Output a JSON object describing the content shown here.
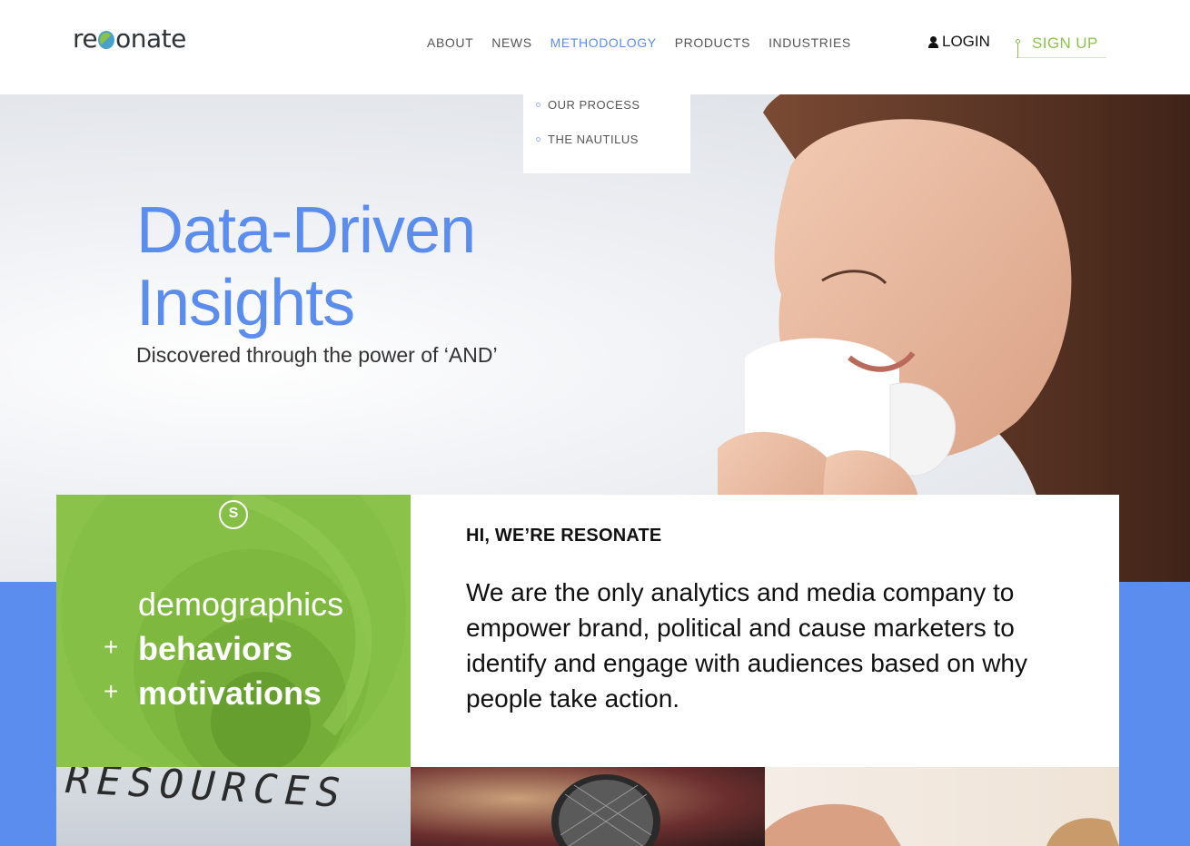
{
  "brand": {
    "logo_left": "re",
    "logo_right": "onate"
  },
  "nav": {
    "items": [
      {
        "label": "ABOUT"
      },
      {
        "label": "NEWS"
      },
      {
        "label": "METHODOLOGY"
      },
      {
        "label": "PRODUCTS"
      },
      {
        "label": "INDUSTRIES"
      }
    ],
    "login_label": "LOGIN",
    "signup_label": "SIGN UP"
  },
  "dropdown": {
    "items": [
      {
        "label": "OUR PROCESS"
      },
      {
        "label": "THE NAUTILUS"
      }
    ]
  },
  "hero": {
    "title_line1": "Data-Driven",
    "title_line2": "Insights",
    "subtitle": "Discovered through the power of ‘AND’"
  },
  "green_card": {
    "line1": "demographics",
    "plus": "+",
    "line2": "behaviors",
    "line3": "motivations"
  },
  "intro": {
    "heading": "HI, WE’RE RESONATE",
    "body": "We are the only analytics and media company to empower brand, political and cause marketers to identify and engage with audiences based on why people take action."
  },
  "tiles": {
    "tile1_text": "RESOURCES"
  },
  "colors": {
    "accent_blue": "#5b8def",
    "accent_green": "#8bc34a"
  }
}
